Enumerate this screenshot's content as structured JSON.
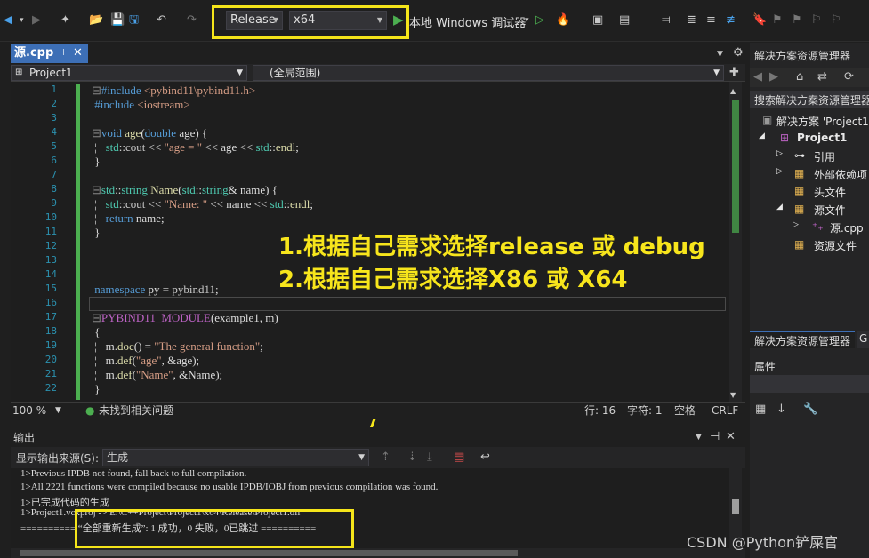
{
  "toolbar": {
    "config_value": "Release",
    "platform_value": "x64",
    "run_label": "本地 Windows 调试器"
  },
  "editor": {
    "file_tab": "源.cpp",
    "project_combo": "Project1",
    "scope_combo": "(全局范围)",
    "line_numbers": [
      "1",
      "2",
      "3",
      "4",
      "5",
      "6",
      "7",
      "8",
      "9",
      "10",
      "11",
      "12",
      "13",
      "14",
      "15",
      "16",
      "17",
      "18",
      "19",
      "20",
      "21",
      "22"
    ],
    "zoom": "100 %",
    "issues": "未找到相关问题",
    "row": "行: 16",
    "col": "字符: 1",
    "spacing": "空格",
    "eol": "CRLF"
  },
  "annotations": {
    "line1": "1.根据自己需求选择release 或 debug",
    "line2": "2.根据自己需求选择X86 或 X64"
  },
  "output": {
    "title": "输出",
    "source_label": "显示输出来源(S):",
    "source_value": "生成",
    "lines": [
      "1>Previous IPDB not found, fall back to full compilation.",
      "1>All 2221 functions were compiled because no usable IPDB/IOBJ from previous compilation was found.",
      "1>已完成代码的生成",
      "1>Project1.vcxproj -> E:\\C++Project\\Project1\\x64\\Release\\Project1.dll",
      "========== “全部重新生成”: 1 成功，0 失败，0已跳过 =========="
    ]
  },
  "solution_explorer": {
    "title": "解决方案资源管理器",
    "search": "搜索解决方案资源管理器",
    "solution": "解决方案 'Project1'",
    "project": "Project1",
    "items": [
      "引用",
      "外部依赖项",
      "头文件",
      "源文件",
      "源.cpp",
      "资源文件"
    ],
    "tab_label": "解决方案资源管理器",
    "tab2_label": "G",
    "properties_title": "属性"
  },
  "watermark": "CSDN @Python铲屎官"
}
